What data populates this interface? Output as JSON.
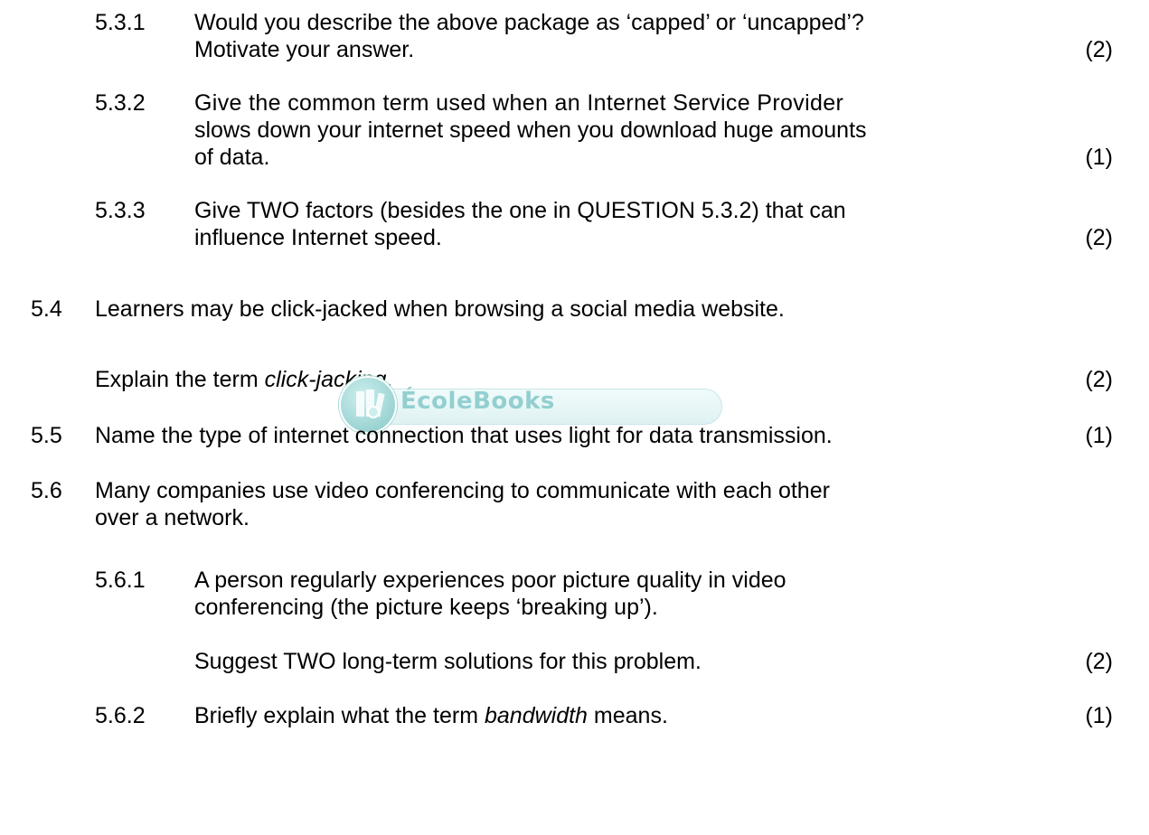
{
  "items": {
    "q531": {
      "number": "5.3.1",
      "line1": "Would you describe the above package as ‘capped’ or ‘uncapped’?",
      "line2": "Motivate your answer.",
      "marks": "(2)"
    },
    "q532": {
      "number": "5.3.2",
      "line1": "Give the common term used when an Internet Service Provider",
      "line2": "slows down your internet speed when you download huge amounts",
      "line3": "of data.",
      "marks": "(1)"
    },
    "q533": {
      "number": "5.3.3",
      "line1": "Give TWO factors (besides the one in QUESTION 5.3.2) that can",
      "line2": "influence Internet speed.",
      "marks": "(2)"
    },
    "q54": {
      "number": "5.4",
      "line1": "Learners may be click-jacked when browsing a social media website.",
      "line2_prefix": "Explain the term ",
      "line2_term": "click-jacking",
      "line2_suffix": ".",
      "marks": "(2)"
    },
    "q55": {
      "number": "5.5",
      "line1": "Name the type of internet connection that uses light for data transmission.",
      "marks": "(1)"
    },
    "q56": {
      "number": "5.6",
      "line1": "Many companies use video conferencing to communicate with each other",
      "line2": "over a network."
    },
    "q561": {
      "number": "5.6.1",
      "line1": "A person regularly experiences poor picture quality in video",
      "line2": "conferencing (the picture keeps ‘breaking up’).",
      "line3": "Suggest TWO long-term solutions for this problem.",
      "marks": "(2)"
    },
    "q562": {
      "number": "5.6.2",
      "prefix": "Briefly explain what the term ",
      "term": "bandwidth",
      "suffix": " means.",
      "marks": "(1)"
    }
  },
  "watermark": {
    "text": "ÉcoleBooks",
    "icon": "book-logo-icon"
  }
}
